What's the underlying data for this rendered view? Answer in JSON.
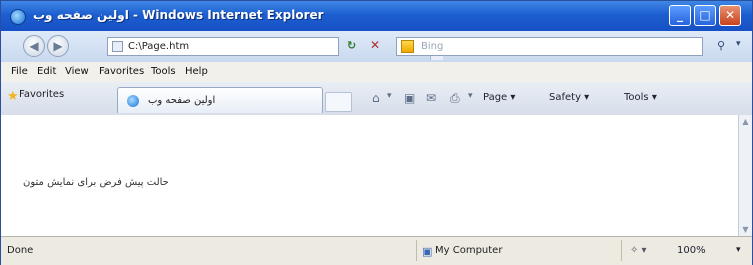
{
  "window": {
    "title": "اولین صفحه وب - Windows Internet Explorer",
    "controls": {
      "minimize": "_",
      "maximize": "□",
      "close": "✕"
    }
  },
  "address_bar": {
    "url": "C:\\Page.htm",
    "search_placeholder": "Bing"
  },
  "menu": [
    "File",
    "Edit",
    "View",
    "Favorites",
    "Tools",
    "Help"
  ],
  "favorites_bar": {
    "favorites_label": "Favorites",
    "tab_title": "اولین صفحه وب"
  },
  "command_bar": {
    "page_label": "Page ▾",
    "safety_label": "Safety ▾",
    "tools_label": "Tools ▾"
  },
  "content": {
    "text": "حالت پیش فرض برای نمایش متون"
  },
  "status_bar": {
    "status": "Done",
    "zone": "My Computer",
    "zoom": "100%"
  },
  "colors": {
    "titlebar": "#1d5fd0",
    "close_button": "#c8431c"
  },
  "icons": [
    "ie-logo-icon",
    "back-icon",
    "forward-icon",
    "refresh-icon",
    "stop-icon",
    "search-icon",
    "favorites-star-icon",
    "home-icon",
    "feeds-icon",
    "mail-icon",
    "print-icon",
    "computer-icon"
  ]
}
